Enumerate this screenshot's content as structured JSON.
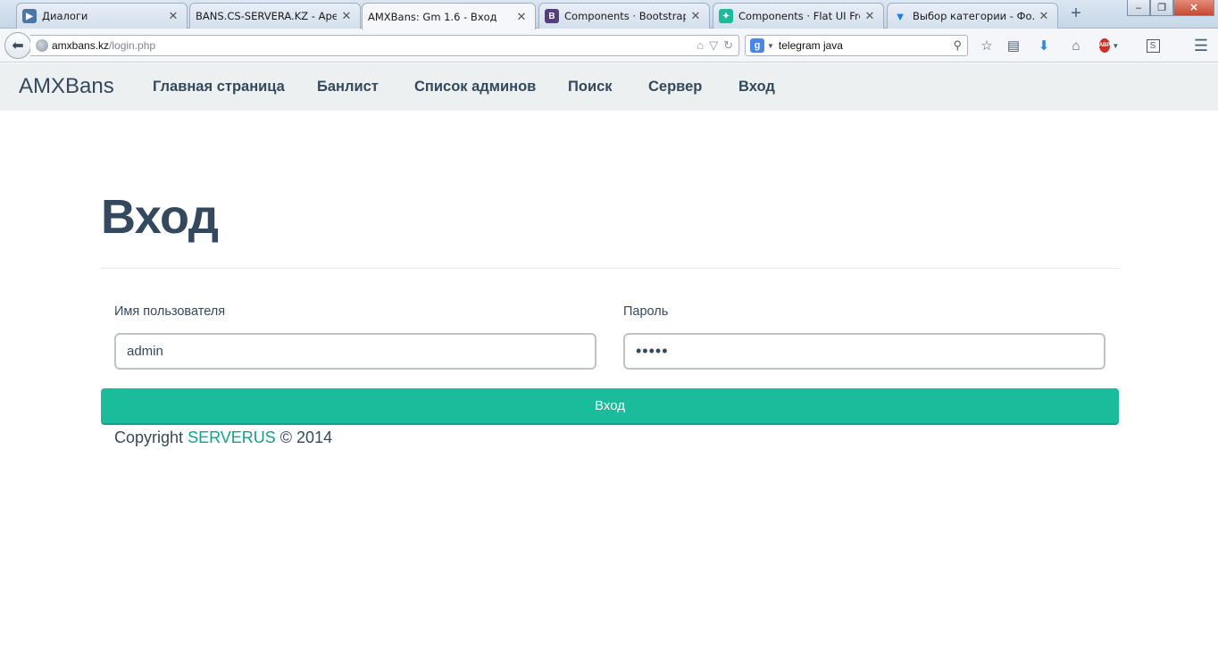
{
  "browser": {
    "tabs": [
      {
        "title": "Диалоги",
        "icon": "vk-icon",
        "icon_color": "#4a76a8",
        "active": false
      },
      {
        "title": "BANS.CS-SERVERA.KZ - Ape...",
        "icon": "none",
        "active": false
      },
      {
        "title": "AMXBans: Gm 1.6 - Вход",
        "icon": "none",
        "active": true
      },
      {
        "title": "Components · Bootstrap",
        "icon": "bootstrap-icon",
        "icon_glyph": "B",
        "icon_color": "#563d7c",
        "active": false
      },
      {
        "title": "Components · Flat UI Free",
        "icon": "flatui-icon",
        "icon_color": "#1abc9c",
        "active": false
      },
      {
        "title": "Выбор категории - Фо...",
        "icon": "forum-icon",
        "icon_color": "#2a7ad8",
        "active": false
      }
    ],
    "new_tab_glyph": "+",
    "window_controls": {
      "minimize": "‒",
      "maximize": "❐",
      "close": "✕"
    },
    "url": {
      "host": "amxbans.kz",
      "path": "/login.php"
    },
    "search": {
      "value": "telegram java",
      "engine_glyph": "g"
    }
  },
  "site": {
    "brand": "AMXBans",
    "nav": [
      {
        "label": "Главная страница"
      },
      {
        "label": "Банлист"
      },
      {
        "label": "Список админов"
      },
      {
        "label": "Поиск"
      },
      {
        "label": "Сервер"
      },
      {
        "label": "Вход"
      }
    ],
    "page_title": "Вход",
    "form": {
      "username_label": "Имя пользователя",
      "username_value": "admin",
      "password_label": "Пароль",
      "password_value": "•••••",
      "submit_label": "Вход"
    },
    "footer": {
      "prefix": "Copyright",
      "link": "SERVERUS",
      "suffix": "© 2014"
    }
  },
  "colors": {
    "accent": "#1abc9c",
    "text": "#34495e",
    "nav_bg": "#ecf0f1"
  }
}
